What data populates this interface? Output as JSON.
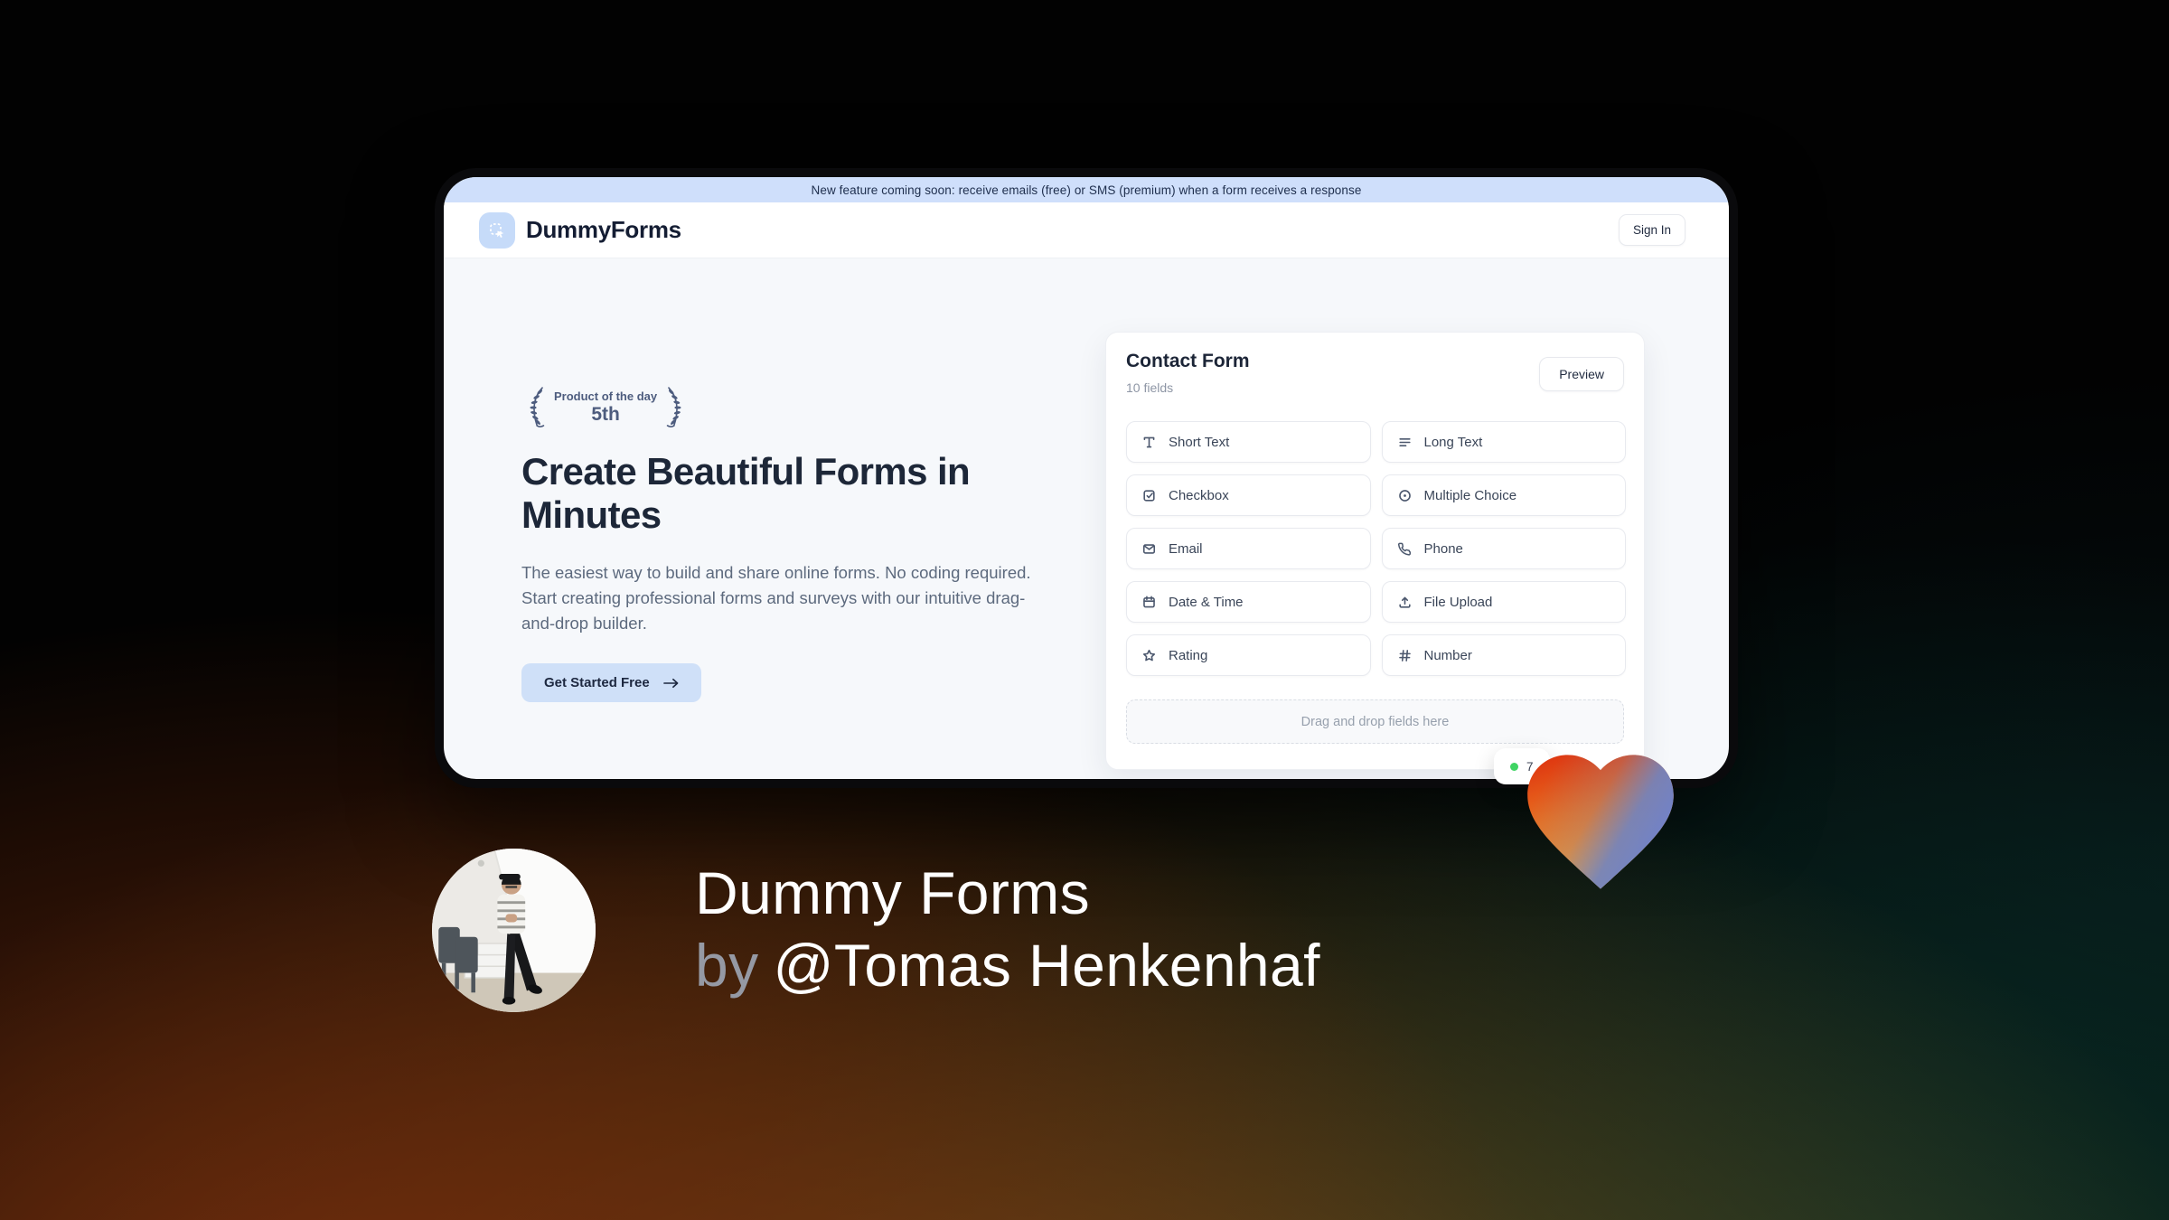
{
  "banner": {
    "text": "New feature coming soon: receive emails (free) or SMS (premium) when a form receives a response"
  },
  "header": {
    "brand": "DummyForms",
    "sign_in_label": "Sign In",
    "logo_icon": "drag-select-cursor-icon"
  },
  "hero": {
    "award": {
      "top": "Product of the day",
      "rank": "5th",
      "icon": "laurel-wreath-icon"
    },
    "title": "Create Beautiful Forms in Minutes",
    "description": "The easiest way to build and share online forms. No coding required. Start creating professional forms and surveys with our intuitive drag-and-drop builder.",
    "cta_label": "Get Started Free",
    "cta_icon": "arrow-right-icon"
  },
  "form_card": {
    "title": "Contact Form",
    "subtitle": "10 fields",
    "preview_label": "Preview",
    "fields": [
      {
        "label": "Short Text",
        "icon": "text-icon"
      },
      {
        "label": "Long Text",
        "icon": "lines-icon"
      },
      {
        "label": "Checkbox",
        "icon": "checkbox-icon"
      },
      {
        "label": "Multiple Choice",
        "icon": "radio-icon"
      },
      {
        "label": "Email",
        "icon": "envelope-icon"
      },
      {
        "label": "Phone",
        "icon": "phone-icon"
      },
      {
        "label": "Date & Time",
        "icon": "calendar-icon"
      },
      {
        "label": "File Upload",
        "icon": "upload-icon"
      },
      {
        "label": "Rating",
        "icon": "star-icon"
      },
      {
        "label": "Number",
        "icon": "hash-icon"
      }
    ],
    "dropzone_text": "Drag and drop fields here",
    "toast": {
      "visible_text": "7",
      "dot_color": "#3fd463"
    }
  },
  "caption": {
    "line1": "Dummy Forms",
    "line2_prefix": "by",
    "line2_name": "@Tomas Henkenhaf"
  },
  "colors": {
    "banner-bg": "#cfdffb",
    "banner-text": "#20304f",
    "accent-chip": "#c6dbf9",
    "hero-bg": "#f6f8fb",
    "heading": "#1d2738",
    "muted": "#5d6a7e",
    "cta-bg": "#cfe0f8",
    "laurel": "#4d5c7e",
    "green-dot": "#3fd463",
    "heart-red": "#dd2e0e",
    "heart-orange": "#f6aa35",
    "heart-blue": "#7282c6"
  }
}
